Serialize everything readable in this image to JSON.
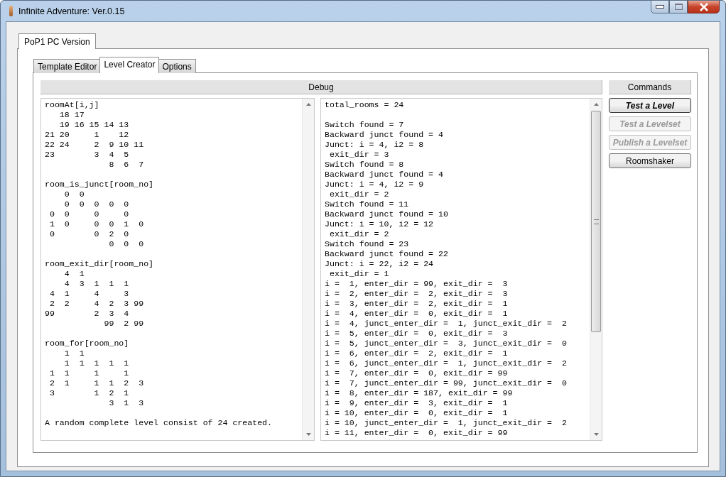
{
  "window": {
    "title": "Infinite Adventure: Ver.0.15"
  },
  "outer_tabs": [
    {
      "label": "PoP1 PC Version",
      "selected": true
    }
  ],
  "inner_tabs": [
    {
      "label": "Template Editor",
      "selected": false
    },
    {
      "label": "Level Creator",
      "selected": true
    },
    {
      "label": "Options",
      "selected": false
    }
  ],
  "debug": {
    "title": "Debug",
    "left_pane": {
      "blocks": [
        [
          "roomAt[i,j]",
          "   18 17",
          "   19 16 15 14 13",
          "21 20     1    12",
          "22 24     2  9 10 11",
          "23        3  4  5",
          "             8  6  7"
        ],
        [
          "room_is_junct[room_no]",
          "    0  0",
          "    0  0  0  0  0",
          " 0  0     0     0",
          " 1  0     0  0  1  0",
          " 0        0  2  0",
          "             0  0  0"
        ],
        [
          "room_exit_dir[room_no]",
          "    4  1",
          "    4  3  1  1  1",
          " 4  1     4     3",
          " 2  2     4  2  3 99",
          "99        2  3  4",
          "            99  2 99"
        ],
        [
          "room_for[room_no]",
          "    1  1",
          "    1  1  1  1  1",
          " 1  1     1     1",
          " 2  1     1  1  2  3",
          " 3        1  2  1",
          "             3  1  3"
        ],
        [
          "A random complete level consist of 24 created."
        ]
      ]
    },
    "right_pane": {
      "blocks": [
        [
          "total_rooms = 24"
        ],
        [
          "Switch found = 7",
          "Backward junct found = 4",
          "Junct: i = 4, i2 = 8",
          " exit_dir = 3",
          "Switch found = 8",
          "Backward junct found = 4",
          "Junct: i = 4, i2 = 9",
          " exit_dir = 2",
          "Switch found = 11",
          "Backward junct found = 10",
          "Junct: i = 10, i2 = 12",
          " exit_dir = 2",
          "Switch found = 23",
          "Backward junct found = 22",
          "Junct: i = 22, i2 = 24",
          " exit_dir = 1",
          "i =  1, enter_dir = 99, exit_dir =  3",
          "i =  2, enter_dir =  2, exit_dir =  3",
          "i =  3, enter_dir =  2, exit_dir =  1",
          "i =  4, enter_dir =  0, exit_dir =  1",
          "i =  4, junct_enter_dir =  1, junct_exit_dir =  2",
          "i =  5, enter_dir =  0, exit_dir =  3",
          "i =  5, junct_enter_dir =  3, junct_exit_dir =  0",
          "i =  6, enter_dir =  2, exit_dir =  1",
          "i =  6, junct_enter_dir =  1, junct_exit_dir =  2",
          "i =  7, enter_dir =  0, exit_dir = 99",
          "i =  7, junct_enter_dir = 99, junct_exit_dir =  0",
          "i =  8, enter_dir = 187, exit_dir = 99",
          "i =  9, enter_dir =  3, exit_dir =  1",
          "i = 10, enter_dir =  0, exit_dir =  1",
          "i = 10, junct_enter_dir =  1, junct_exit_dir =  2",
          "i = 11, enter_dir =  0, exit_dir = 99"
        ]
      ]
    }
  },
  "commands": {
    "title": "Commands",
    "buttons": [
      {
        "label": "Test a Level",
        "disabled": false,
        "default": true,
        "bold_italic": true
      },
      {
        "label": "Test a Levelset",
        "disabled": true,
        "default": false,
        "bold_italic": true
      },
      {
        "label": "Publish a Levelset",
        "disabled": true,
        "default": false,
        "bold_italic": true
      },
      {
        "label": "Roomshaker",
        "disabled": false,
        "default": false,
        "bold_italic": false
      }
    ]
  }
}
